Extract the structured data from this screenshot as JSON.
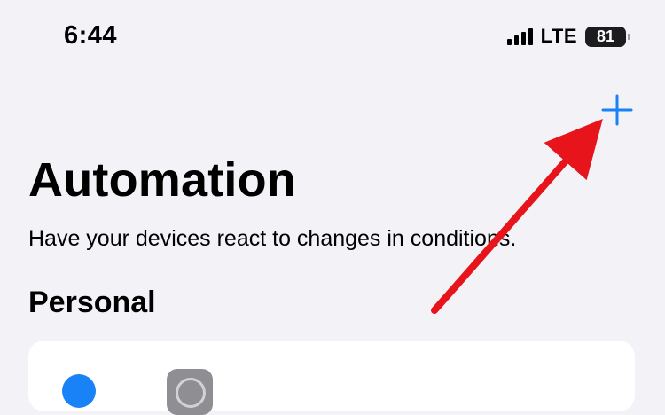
{
  "status_bar": {
    "time": "6:44",
    "network": "LTE",
    "battery": "81"
  },
  "header": {
    "title": "Automation",
    "subtitle": "Have your devices react to changes in conditions."
  },
  "section": {
    "title": "Personal"
  },
  "icons": {
    "add": "plus-icon",
    "signal": "signal-icon",
    "battery": "battery-icon",
    "gear": "gear-icon"
  },
  "colors": {
    "accent": "#1a82f7",
    "background": "#f2f2f7",
    "annotation": "#e8141b"
  }
}
